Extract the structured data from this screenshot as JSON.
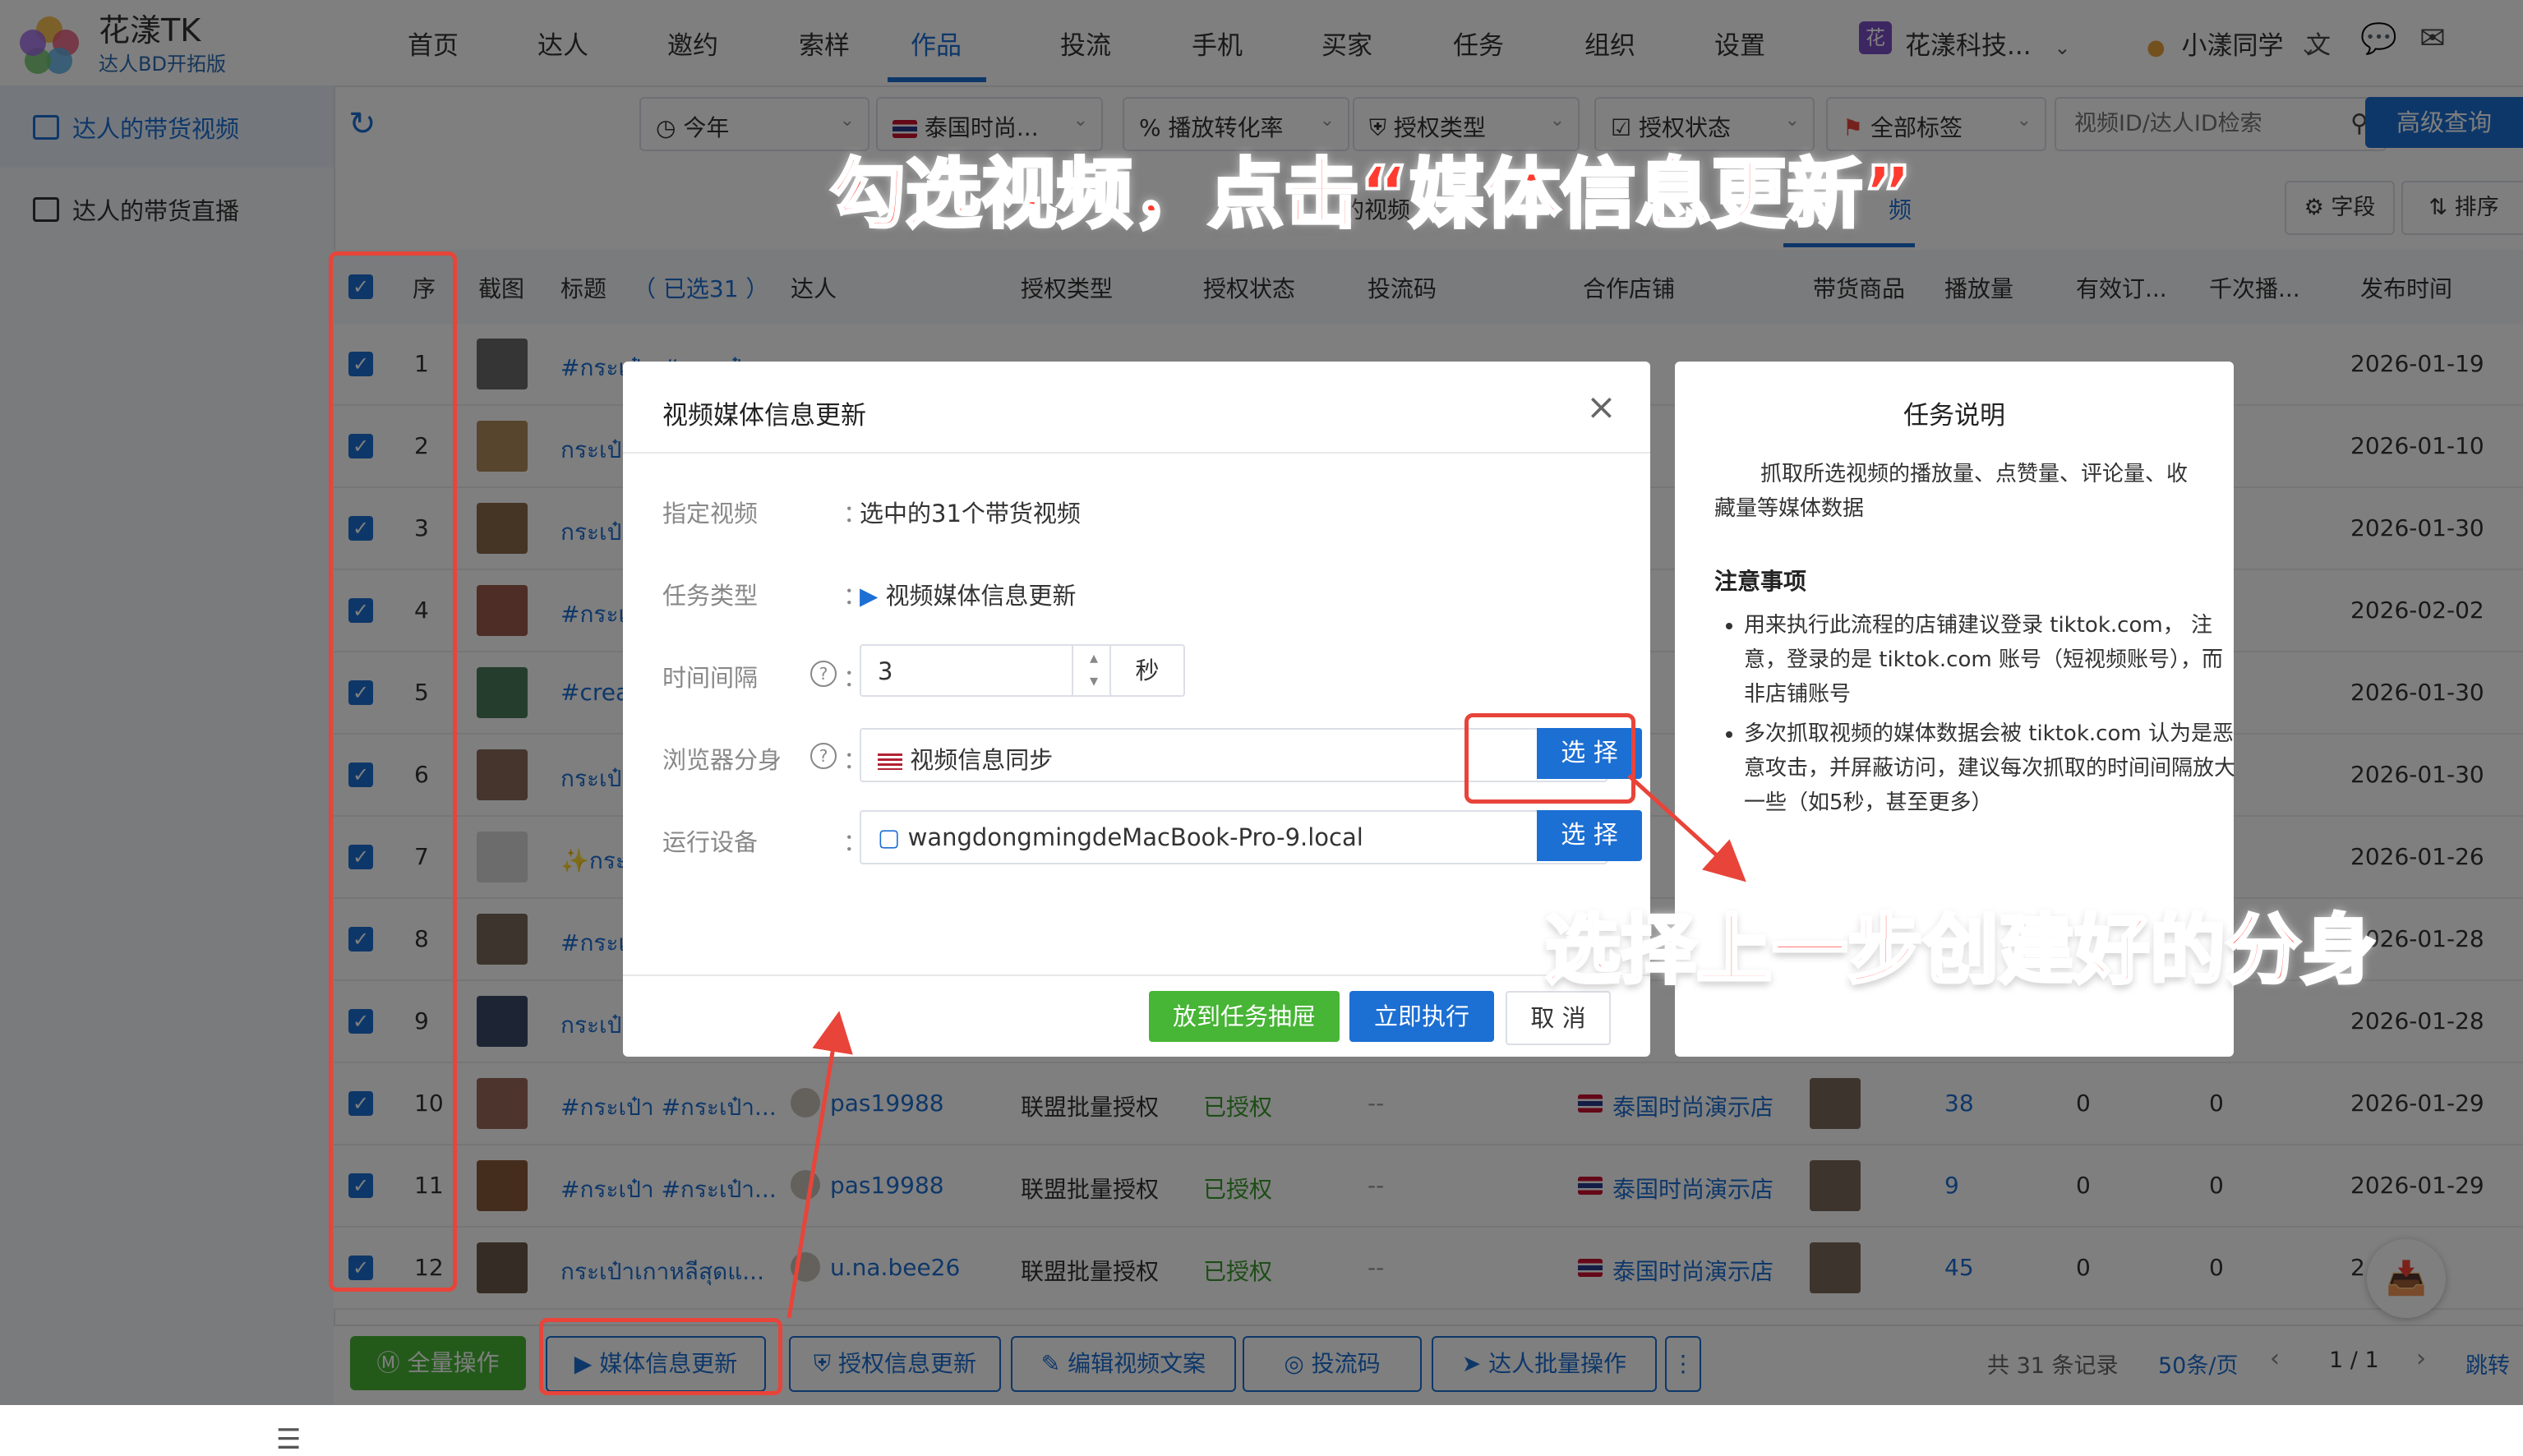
{
  "app": {
    "title": "花漾TK",
    "subtitle": "达人BD开拓版"
  },
  "nav": {
    "items": [
      "首页",
      "达人",
      "邀约",
      "索样",
      "作品",
      "投流",
      "手机",
      "买家",
      "任务",
      "组织",
      "设置"
    ],
    "active": "作品",
    "org_badge": "花",
    "org_name": "花漾科技...",
    "user_name": "小漾同学"
  },
  "sidebar": {
    "items": [
      {
        "label": "达人的带货视频",
        "active": true
      },
      {
        "label": "达人的带货直播",
        "active": false
      }
    ]
  },
  "filters": {
    "year": "今年",
    "shop": "泰国时尚...",
    "conversion": "播放转化率",
    "auth_type": "授权类型",
    "auth_status": "授权状态",
    "tags": "全部标签",
    "search_placeholder": "视频ID/达人ID检索",
    "advanced": "高级查询"
  },
  "tabs": {
    "video_partial": "的视频",
    "right_partial": "频",
    "fields": "字段",
    "sort": "排序"
  },
  "table": {
    "headers": {
      "seq": "序",
      "thumb": "截图",
      "title": "标题",
      "selected": "（ 已选31 ）",
      "creator": "达人",
      "auth_type": "授权类型",
      "auth_status": "授权状态",
      "ad_code": "投流码",
      "shop": "合作店铺",
      "product": "带货商品",
      "plays": "播放量",
      "valid_orders": "有效订...",
      "cpm": "千次播...",
      "publish": "发布时间"
    },
    "rows": [
      {
        "seq": "1",
        "title": "#กระเป๋า #กระเป๋า",
        "date": "2026-01-19"
      },
      {
        "seq": "2",
        "title": "กระเป๋า",
        "date": "2026-01-10"
      },
      {
        "seq": "3",
        "title": "กระเป๋า",
        "date": "2026-01-30"
      },
      {
        "seq": "4",
        "title": "#กระเ",
        "date": "2026-02-02"
      },
      {
        "seq": "5",
        "title": "#crea",
        "date": "2026-01-30"
      },
      {
        "seq": "6",
        "title": "กระเป๋า",
        "date": "2026-01-30"
      },
      {
        "seq": "7",
        "title": "✨กระเ",
        "date": "2026-01-26"
      },
      {
        "seq": "8",
        "title": "#กระเ",
        "date": "2026-01-28"
      },
      {
        "seq": "9",
        "title": "กระเป๋า",
        "date": "2026-01-28"
      },
      {
        "seq": "10",
        "title": "#กระเป๋า #กระเป๋า...",
        "creator": "pas19988",
        "auth_type": "联盟批量授权",
        "auth_status": "已授权",
        "ad_code": "--",
        "shop": "泰国时尚演示店",
        "plays": "38",
        "valid_orders": "0",
        "cpm": "0",
        "date": "2026-01-29"
      },
      {
        "seq": "11",
        "title": "#กระเป๋า #กระเป๋า...",
        "creator": "pas19988",
        "auth_type": "联盟批量授权",
        "auth_status": "已授权",
        "ad_code": "--",
        "shop": "泰国时尚演示店",
        "plays": "9",
        "valid_orders": "0",
        "cpm": "0",
        "date": "2026-01-29"
      },
      {
        "seq": "12",
        "title": "กระเป๋าเกาหลีสุดแ...",
        "creator": "u.na.bee26",
        "auth_type": "联盟批量授权",
        "auth_status": "已授权",
        "ad_code": "--",
        "shop": "泰国时尚演示店",
        "plays": "45",
        "valid_orders": "0",
        "cpm": "0",
        "date": "2"
      }
    ]
  },
  "modal": {
    "title": "视频媒体信息更新",
    "fields": {
      "video_label": "指定视频",
      "video_value": "选中的31个带货视频",
      "task_type_label": "任务类型",
      "task_type_value": "视频媒体信息更新",
      "interval_label": "时间间隔",
      "interval_value": "3",
      "interval_unit": "秒",
      "browser_label": "浏览器分身",
      "browser_value": "视频信息同步",
      "device_label": "运行设备",
      "device_value": "wangdongmingdeMacBook-Pro-9.local",
      "colon": "：",
      "help": "?"
    },
    "select_button": "选 择",
    "buttons": {
      "drawer": "放到任务抽屉",
      "run": "立即执行",
      "cancel": "取 消"
    }
  },
  "task_panel": {
    "title": "任务说明",
    "description": "抓取所选视频的播放量、点赞量、评论量、收藏量等媒体数据",
    "notes_title": "注意事项",
    "notes": [
      "用来执行此流程的店铺建议登录 tiktok.com， 注意，登录的是 tiktok.com 账号（短视频账号），而非店铺账号",
      "多次抓取视频的媒体数据会被 tiktok.com 认为是恶意攻击，并屏蔽访问，建议每次抓取的时间间隔放大一些（如5秒，甚至更多）"
    ]
  },
  "bottom_bar": {
    "all_ops": "全量操作",
    "media_update": "媒体信息更新",
    "auth_update": "授权信息更新",
    "edit_copy": "编辑视频文案",
    "ad_code": "投流码",
    "batch_ops": "达人批量操作",
    "total": "共 31 条记录",
    "page_size": "50条/页",
    "page": "1 / 1",
    "jump": "跳转"
  },
  "annotations": {
    "top": "勾选视频，点击“媒体信息更新”",
    "middle": "选择上一步创建好的分身"
  },
  "colors": {
    "primary": "#1c6fd3",
    "success": "#47b535",
    "annotation": "#ff3b30",
    "annotation_box": "#e8443a"
  }
}
